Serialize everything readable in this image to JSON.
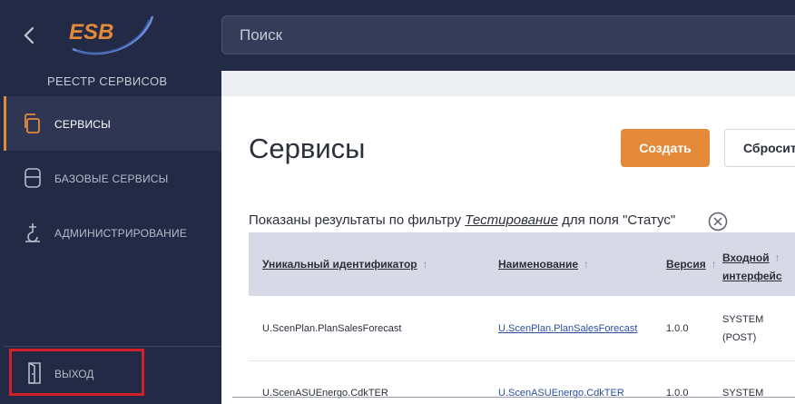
{
  "header": {
    "logo_text": "ESB",
    "search_placeholder": "Поиск"
  },
  "sidebar": {
    "registry_title": "РЕЕСТР СЕРВИСОВ",
    "items": [
      {
        "label": "СЕРВИСЫ",
        "icon": "copy-documents-icon",
        "active": true
      },
      {
        "label": "БАЗОВЫЕ СЕРВИСЫ",
        "icon": "database-icon",
        "active": false
      },
      {
        "label": "АДМИНИСТРИРОВАНИЕ",
        "icon": "admin-hook-icon",
        "active": false
      }
    ],
    "exit_label": "ВЫХОД",
    "exit_icon": "door-exit-icon"
  },
  "main": {
    "title": "Сервисы",
    "create_label": "Создать",
    "reset_label": "Сбросить",
    "filter": {
      "prefix": "Показаны результаты по фильтру",
      "value": "Тестирование",
      "suffix": "для поля \"Статус\""
    },
    "table": {
      "columns": [
        {
          "label": "Уникальный идентификатор",
          "sort_icon": "arrow-up-icon"
        },
        {
          "label": "Наименование",
          "sort_icon": "arrow-up-icon"
        },
        {
          "label": "Версия",
          "sort_icon": "arrow-up-icon"
        },
        {
          "label": "Входной",
          "label2": "интерфейс",
          "sort_icon": "arrow-up-icon"
        }
      ],
      "rows": [
        {
          "id": "U.ScenPlan.PlanSalesForecast",
          "name": "U.ScenPlan.PlanSalesForecast",
          "version": "1.0.0",
          "iface1": "SYSTEM",
          "iface2": "(POST)"
        },
        {
          "id": "U.ScenASUEnergo.CdkTER",
          "name": "U.ScenASUEnergo.CdkTER",
          "version": "1.0.0",
          "iface1": "SYSTEM",
          "iface2": ""
        }
      ]
    }
  },
  "colors": {
    "sidebar_bg": "#232a45",
    "accent": "#e48a39",
    "highlight_border": "#d22127",
    "link": "#2a4fa0"
  }
}
